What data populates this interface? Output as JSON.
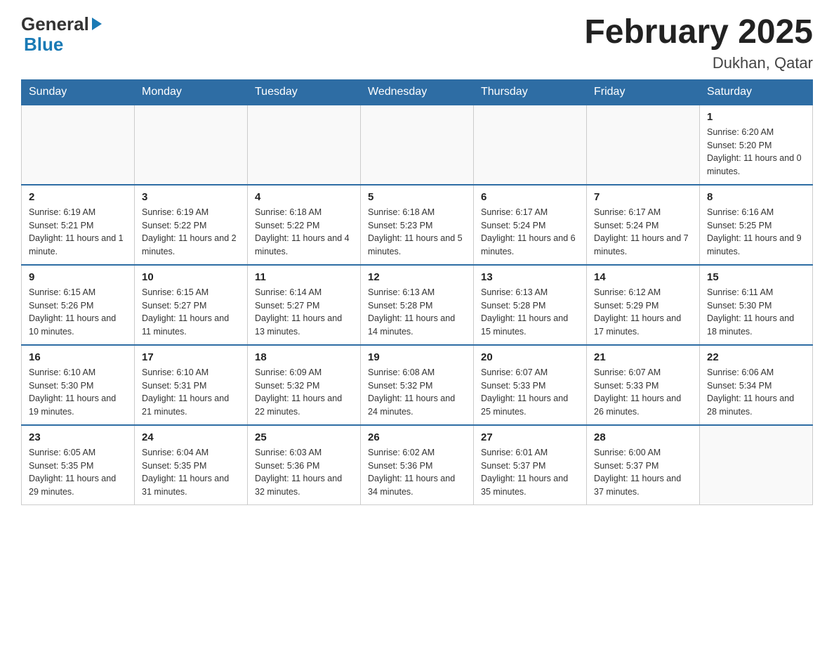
{
  "header": {
    "logo_general": "General",
    "logo_blue": "Blue",
    "title": "February 2025",
    "subtitle": "Dukhan, Qatar"
  },
  "days_of_week": [
    "Sunday",
    "Monday",
    "Tuesday",
    "Wednesday",
    "Thursday",
    "Friday",
    "Saturday"
  ],
  "weeks": [
    [
      {
        "day": "",
        "info": ""
      },
      {
        "day": "",
        "info": ""
      },
      {
        "day": "",
        "info": ""
      },
      {
        "day": "",
        "info": ""
      },
      {
        "day": "",
        "info": ""
      },
      {
        "day": "",
        "info": ""
      },
      {
        "day": "1",
        "info": "Sunrise: 6:20 AM\nSunset: 5:20 PM\nDaylight: 11 hours and 0 minutes."
      }
    ],
    [
      {
        "day": "2",
        "info": "Sunrise: 6:19 AM\nSunset: 5:21 PM\nDaylight: 11 hours and 1 minute."
      },
      {
        "day": "3",
        "info": "Sunrise: 6:19 AM\nSunset: 5:22 PM\nDaylight: 11 hours and 2 minutes."
      },
      {
        "day": "4",
        "info": "Sunrise: 6:18 AM\nSunset: 5:22 PM\nDaylight: 11 hours and 4 minutes."
      },
      {
        "day": "5",
        "info": "Sunrise: 6:18 AM\nSunset: 5:23 PM\nDaylight: 11 hours and 5 minutes."
      },
      {
        "day": "6",
        "info": "Sunrise: 6:17 AM\nSunset: 5:24 PM\nDaylight: 11 hours and 6 minutes."
      },
      {
        "day": "7",
        "info": "Sunrise: 6:17 AM\nSunset: 5:24 PM\nDaylight: 11 hours and 7 minutes."
      },
      {
        "day": "8",
        "info": "Sunrise: 6:16 AM\nSunset: 5:25 PM\nDaylight: 11 hours and 9 minutes."
      }
    ],
    [
      {
        "day": "9",
        "info": "Sunrise: 6:15 AM\nSunset: 5:26 PM\nDaylight: 11 hours and 10 minutes."
      },
      {
        "day": "10",
        "info": "Sunrise: 6:15 AM\nSunset: 5:27 PM\nDaylight: 11 hours and 11 minutes."
      },
      {
        "day": "11",
        "info": "Sunrise: 6:14 AM\nSunset: 5:27 PM\nDaylight: 11 hours and 13 minutes."
      },
      {
        "day": "12",
        "info": "Sunrise: 6:13 AM\nSunset: 5:28 PM\nDaylight: 11 hours and 14 minutes."
      },
      {
        "day": "13",
        "info": "Sunrise: 6:13 AM\nSunset: 5:28 PM\nDaylight: 11 hours and 15 minutes."
      },
      {
        "day": "14",
        "info": "Sunrise: 6:12 AM\nSunset: 5:29 PM\nDaylight: 11 hours and 17 minutes."
      },
      {
        "day": "15",
        "info": "Sunrise: 6:11 AM\nSunset: 5:30 PM\nDaylight: 11 hours and 18 minutes."
      }
    ],
    [
      {
        "day": "16",
        "info": "Sunrise: 6:10 AM\nSunset: 5:30 PM\nDaylight: 11 hours and 19 minutes."
      },
      {
        "day": "17",
        "info": "Sunrise: 6:10 AM\nSunset: 5:31 PM\nDaylight: 11 hours and 21 minutes."
      },
      {
        "day": "18",
        "info": "Sunrise: 6:09 AM\nSunset: 5:32 PM\nDaylight: 11 hours and 22 minutes."
      },
      {
        "day": "19",
        "info": "Sunrise: 6:08 AM\nSunset: 5:32 PM\nDaylight: 11 hours and 24 minutes."
      },
      {
        "day": "20",
        "info": "Sunrise: 6:07 AM\nSunset: 5:33 PM\nDaylight: 11 hours and 25 minutes."
      },
      {
        "day": "21",
        "info": "Sunrise: 6:07 AM\nSunset: 5:33 PM\nDaylight: 11 hours and 26 minutes."
      },
      {
        "day": "22",
        "info": "Sunrise: 6:06 AM\nSunset: 5:34 PM\nDaylight: 11 hours and 28 minutes."
      }
    ],
    [
      {
        "day": "23",
        "info": "Sunrise: 6:05 AM\nSunset: 5:35 PM\nDaylight: 11 hours and 29 minutes."
      },
      {
        "day": "24",
        "info": "Sunrise: 6:04 AM\nSunset: 5:35 PM\nDaylight: 11 hours and 31 minutes."
      },
      {
        "day": "25",
        "info": "Sunrise: 6:03 AM\nSunset: 5:36 PM\nDaylight: 11 hours and 32 minutes."
      },
      {
        "day": "26",
        "info": "Sunrise: 6:02 AM\nSunset: 5:36 PM\nDaylight: 11 hours and 34 minutes."
      },
      {
        "day": "27",
        "info": "Sunrise: 6:01 AM\nSunset: 5:37 PM\nDaylight: 11 hours and 35 minutes."
      },
      {
        "day": "28",
        "info": "Sunrise: 6:00 AM\nSunset: 5:37 PM\nDaylight: 11 hours and 37 minutes."
      },
      {
        "day": "",
        "info": ""
      }
    ]
  ]
}
